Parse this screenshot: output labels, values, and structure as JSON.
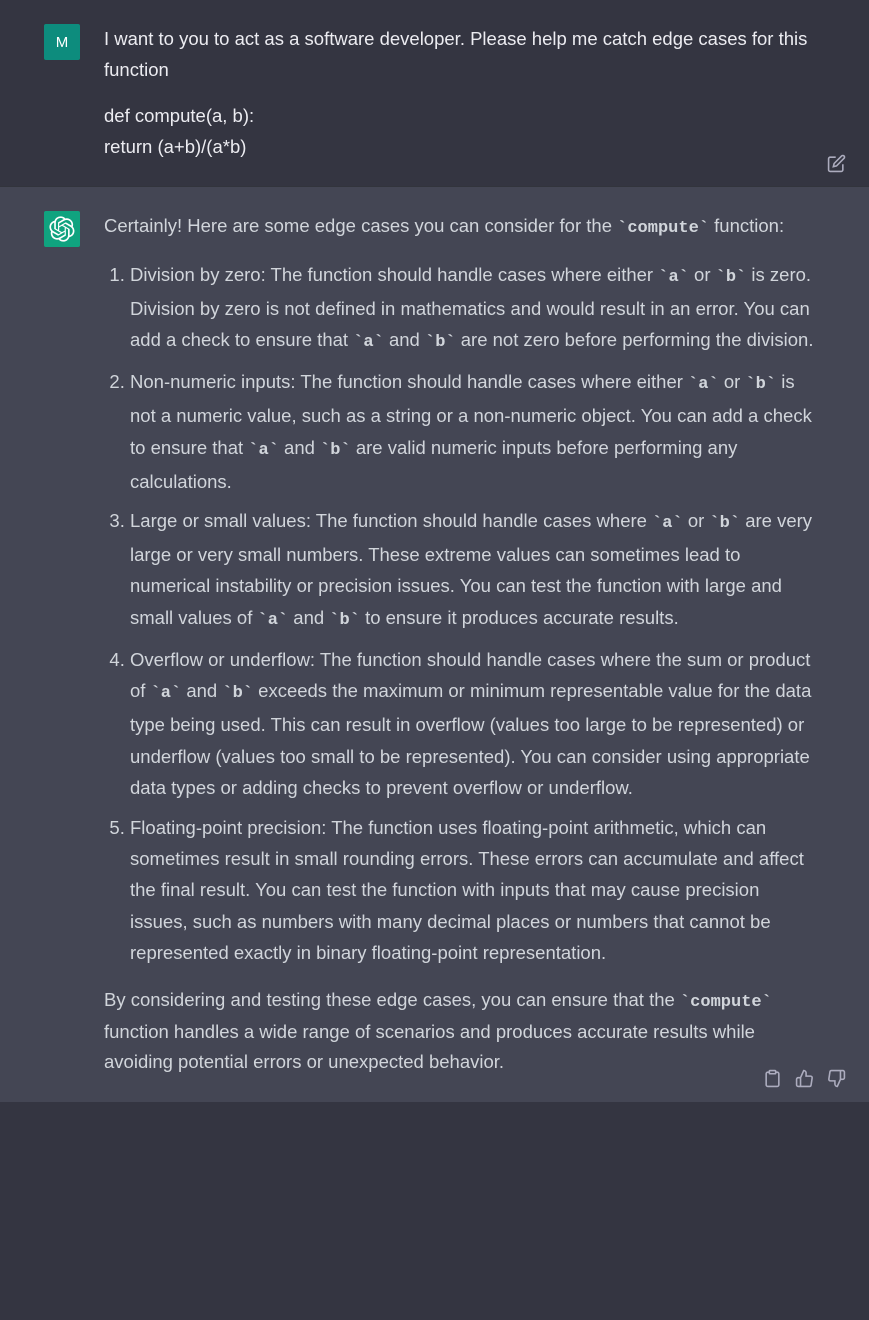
{
  "user": {
    "avatar_letter": "M",
    "message_intro": "I want to you to act as a software developer. Please help me catch edge cases for this function",
    "code_line1": "def compute(a, b):",
    "code_line2": "return (a+b)/(a*b)"
  },
  "assistant": {
    "intro_pre": "Certainly! Here are some edge cases you can consider for the ",
    "intro_code": "`compute`",
    "intro_post": " function:",
    "items": [
      {
        "t1": "Division by zero: The function should handle cases where either ",
        "c1": "`a`",
        "t2": " or ",
        "c2": "`b`",
        "t3": " is zero. Division by zero is not defined in mathematics and would result in an error. You can add a check to ensure that ",
        "c3": "`a`",
        "t4": " and ",
        "c4": "`b`",
        "t5": " are not zero before performing the division."
      },
      {
        "t1": "Non-numeric inputs: The function should handle cases where either ",
        "c1": "`a`",
        "t2": " or ",
        "c2": "`b`",
        "t3": " is not a numeric value, such as a string or a non-numeric object. You can add a check to ensure that ",
        "c3": "`a`",
        "t4": " and ",
        "c4": "`b`",
        "t5": " are valid numeric inputs before performing any calculations."
      },
      {
        "t1": "Large or small values: The function should handle cases where ",
        "c1": "`a`",
        "t2": " or ",
        "c2": "`b`",
        "t3": " are very large or very small numbers. These extreme values can sometimes lead to numerical instability or precision issues. You can test the function with large and small values of ",
        "c3": "`a`",
        "t4": " and ",
        "c4": "`b`",
        "t5": " to ensure it produces accurate results."
      },
      {
        "t1": "Overflow or underflow: The function should handle cases where the sum or product of ",
        "c1": "`a`",
        "t2": " and ",
        "c2": "`b`",
        "t3": " exceeds the maximum or minimum representable value for the data type being used. This can result in overflow (values too large to be represented) or underflow (values too small to be represented). You can consider using appropriate data types or adding checks to prevent overflow or underflow.",
        "c3": "",
        "t4": "",
        "c4": "",
        "t5": ""
      },
      {
        "t1": "Floating-point precision: The function uses floating-point arithmetic, which can sometimes result in small rounding errors. These errors can accumulate and affect the final result. You can test the function with inputs that may cause precision issues, such as numbers with many decimal places or numbers that cannot be represented exactly in binary floating-point representation.",
        "c1": "",
        "t2": "",
        "c2": "",
        "t3": "",
        "c3": "",
        "t4": "",
        "c4": "",
        "t5": ""
      }
    ],
    "outro_pre": "By considering and testing these edge cases, you can ensure that the ",
    "outro_code": "`compute`",
    "outro_post": " function handles a wide range of scenarios and produces accurate results while avoiding potential errors or unexpected behavior."
  }
}
